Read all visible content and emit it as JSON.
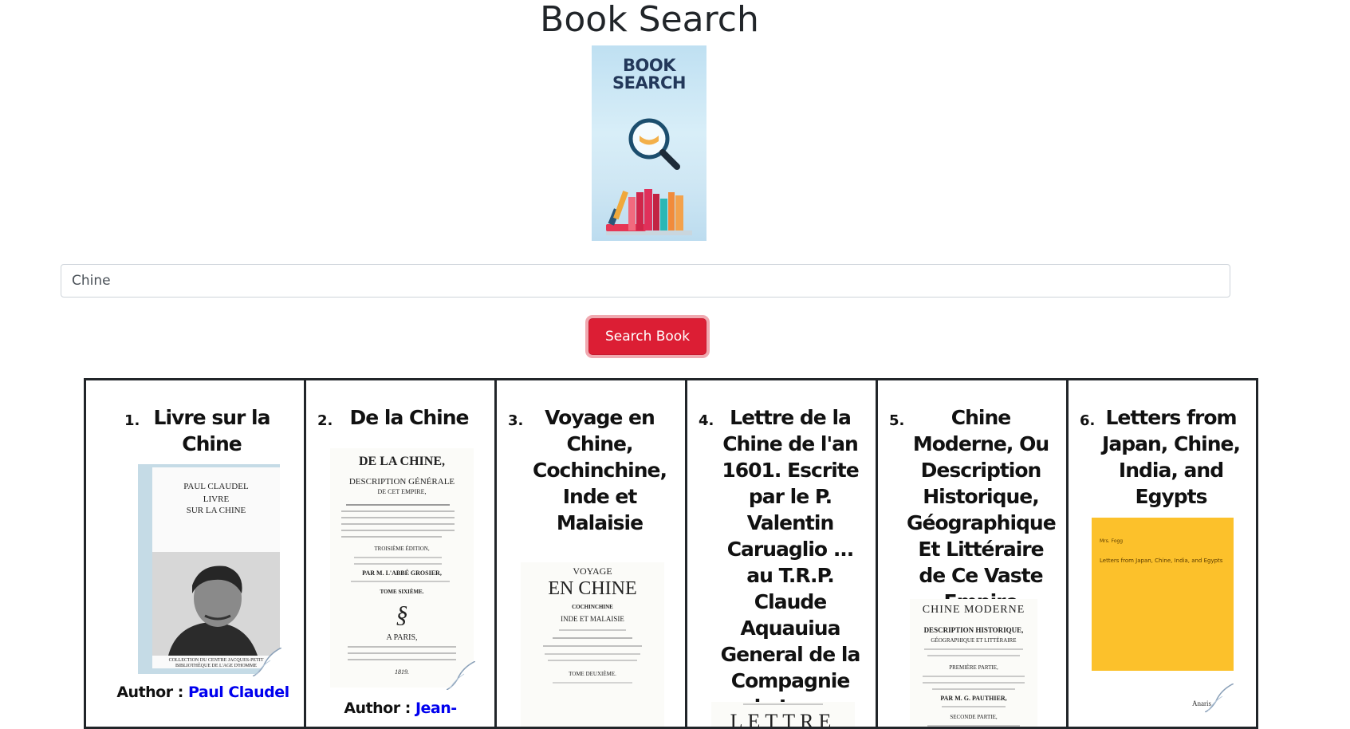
{
  "page": {
    "title": "Book Search"
  },
  "logo": {
    "line1": "BOOK",
    "line2": "SEARCH"
  },
  "search": {
    "value": "Chine"
  },
  "button": {
    "label": "Search Book"
  },
  "author_label": "Author :",
  "results": [
    {
      "number": "1.",
      "title": "Livre sur la Chine",
      "author": "Paul Claudel",
      "cover": [
        "PAUL CLAUDEL",
        "LIVRE",
        "SUR LA CHINE",
        "COLLECTION DU CENTRE JACQUES-PETIT",
        "BIBLIOTHÈQUE DE L'AGE D'HOMME"
      ]
    },
    {
      "number": "2.",
      "title": "De la Chine",
      "author": "Jean-",
      "cover": [
        "DE LA CHINE,",
        "DESCRIPTION GÉNÉRALE",
        "DE CET EMPIRE,",
        "TROISIÈME ÉDITION,",
        "PAR M. L'ABBÉ GROSIER,",
        "TOME SIXIÈME.",
        "A PARIS,",
        "1819."
      ]
    },
    {
      "number": "3.",
      "title": "Voyage en Chine, Cochinchine, Inde et Malaisie",
      "author": "",
      "cover": [
        "VOYAGE",
        "EN CHINE",
        "COCHINCHINE",
        "INDE ET MALAISIE",
        "TOME DEUXIÈME."
      ]
    },
    {
      "number": "4.",
      "title": "Lettre de la Chine de l'an 1601. Escrite par le P. Valentin Caruaglio ... au T.R.P. Claude Aquauiua General de la Compagnie de Iesus",
      "author": "",
      "cover": [
        "LETTRE"
      ]
    },
    {
      "number": "5.",
      "title": "Chine Moderne, Ou Description Historique, Géographique Et Littéraire de Ce Vaste Empire",
      "author": "",
      "cover": [
        "CHINE MODERNE",
        "DESCRIPTION HISTORIQUE,",
        "GÉOGRAPHIQUE ET LITTÉRAIRE",
        "PREMIÈRE PARTIE,",
        "PAR M. G. PAUTHIER,",
        "SECONDE PARTIE,"
      ]
    },
    {
      "number": "6.",
      "title": "Letters from Japan, Chine, India, and Egypts",
      "author": "",
      "cover": [
        "Mrs. Fogg",
        "Letters from Japan, Chine, India, and Egypts",
        "Anaris"
      ]
    }
  ],
  "colors": {
    "button": "#dc1e34",
    "author_link": "#0000ee",
    "cover6": "#fcc12b"
  }
}
